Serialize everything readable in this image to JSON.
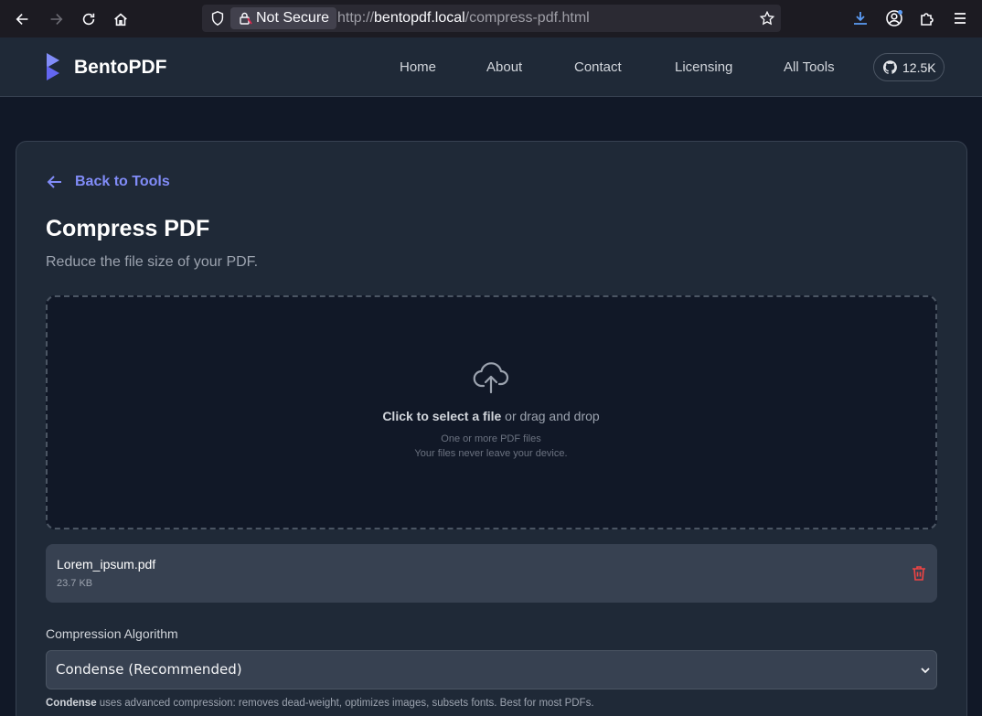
{
  "browser": {
    "not_secure_label": "Not Secure",
    "url_prefix": "http://",
    "url_host": "bentopdf.local",
    "url_path": "/compress-pdf.html"
  },
  "header": {
    "brand": "BentoPDF",
    "nav": [
      "Home",
      "About",
      "Contact",
      "Licensing",
      "All Tools"
    ],
    "github_stars": "12.5K"
  },
  "main": {
    "back_label": "Back to Tools",
    "title": "Compress PDF",
    "subtitle": "Reduce the file size of your PDF.",
    "dropzone": {
      "cta_bold": "Click to select a file",
      "cta_rest": " or drag and drop",
      "hint_1": "One or more PDF files",
      "hint_2": "Your files never leave your device."
    },
    "file": {
      "name": "Lorem_ipsum.pdf",
      "size": "23.7 KB"
    },
    "algorithm": {
      "label": "Compression Algorithm",
      "selected": "Condense (Recommended)",
      "desc_bold": "Condense",
      "desc_rest": " uses advanced compression: removes dead-weight, optimizes images, subsets fonts. Best for most PDFs."
    }
  },
  "colors": {
    "accent": "#818cf8",
    "danger": "#ef4444",
    "background": "#111827",
    "card": "#1f2937"
  }
}
